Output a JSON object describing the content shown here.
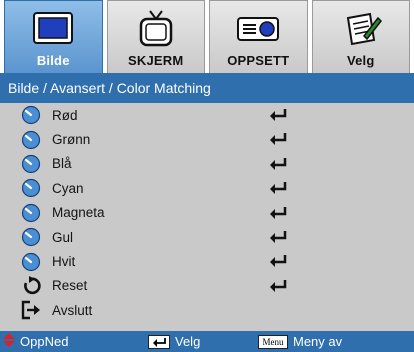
{
  "tabs": [
    {
      "label": "Bilde",
      "icon": "monitor-icon",
      "active": true
    },
    {
      "label": "SKJERM",
      "icon": "tv-icon",
      "active": false
    },
    {
      "label": "OPPSETT",
      "icon": "projector-icon",
      "active": false
    },
    {
      "label": "Velg",
      "icon": "notepad-icon",
      "active": false
    }
  ],
  "breadcrumb": "Bilde / Avansert / Color Matching",
  "items": [
    {
      "label": "Rød",
      "icon": "color-dial-icon"
    },
    {
      "label": "Grønn",
      "icon": "color-dial-icon"
    },
    {
      "label": "Blå",
      "icon": "color-dial-icon"
    },
    {
      "label": "Cyan",
      "icon": "color-dial-icon"
    },
    {
      "label": "Magneta",
      "icon": "color-dial-icon"
    },
    {
      "label": "Gul",
      "icon": "color-dial-icon"
    },
    {
      "label": "Hvit",
      "icon": "color-dial-icon"
    },
    {
      "label": "Reset",
      "icon": "reset-icon"
    },
    {
      "label": "Avslutt",
      "icon": "exit-icon"
    }
  ],
  "status": {
    "updown_label": "OppNed",
    "enter_label": "Velg",
    "menu_key": "Menu",
    "menu_label": "Meny av"
  },
  "colors": {
    "accent_blue": "#2f6fad",
    "panel_gray": "#c9c9c9",
    "tab_active": "#6aa3d8",
    "status_arrow_red": "#e02020"
  }
}
